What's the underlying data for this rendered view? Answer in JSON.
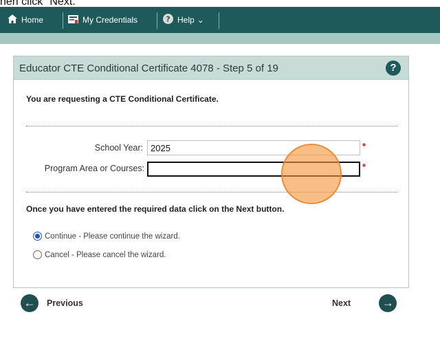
{
  "caption": "hen click \"Next.\"",
  "nav": {
    "home": "Home",
    "credentials": "My Credentials",
    "help": "Help",
    "help_chevron": "⌄"
  },
  "panel": {
    "title": "Educator CTE Conditional Certificate 4078 - Step 5 of 19",
    "help_glyph": "?",
    "intro": "You are requesting a CTE Conditional Certificate.",
    "fields": {
      "school_year_label": "School Year:",
      "school_year_value": "2025",
      "program_area_label": "Program Area or Courses:",
      "program_area_value": "",
      "required_mark": "*"
    },
    "instruction": "Once you have entered the required data click on the Next button.",
    "options": {
      "continue": "Continue - Please continue the wizard.",
      "cancel": "Cancel - Please cancel the wizard."
    }
  },
  "footer": {
    "previous": "Previous",
    "next": "Next"
  },
  "colors": {
    "navbar": "#1e5a5a",
    "accent": "#1f5a5a",
    "header": "#c7dcd6",
    "highlight": "#f5963c"
  }
}
